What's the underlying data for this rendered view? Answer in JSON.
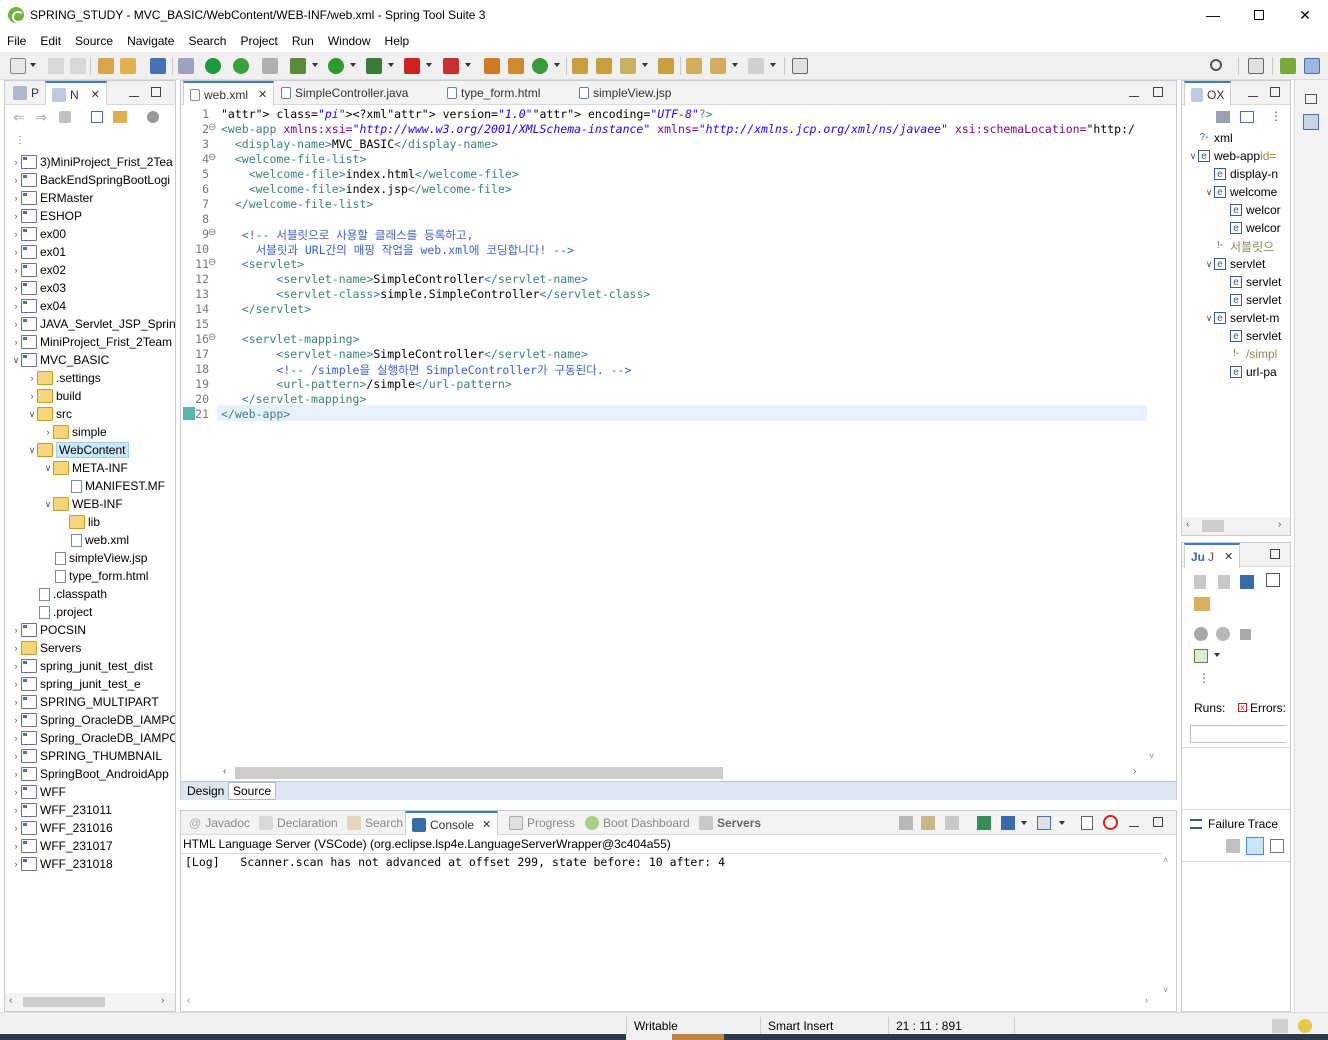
{
  "window": {
    "title": "SPRING_STUDY - MVC_BASIC/WebContent/WEB-INF/web.xml - Spring Tool Suite 3"
  },
  "menu": [
    "File",
    "Edit",
    "Source",
    "Navigate",
    "Search",
    "Project",
    "Run",
    "Window",
    "Help"
  ],
  "explorer": {
    "tabs": [
      "P",
      "N"
    ],
    "items": [
      {
        "label": "3)MiniProject_Frist_2Tea",
        "type": "project",
        "level": 0,
        "open": false
      },
      {
        "label": "BackEndSpringBootLogi",
        "type": "project",
        "level": 0,
        "open": false
      },
      {
        "label": "ERMaster",
        "type": "project",
        "level": 0,
        "open": false
      },
      {
        "label": "ESHOP",
        "type": "project",
        "level": 0,
        "open": false
      },
      {
        "label": "ex00",
        "type": "project",
        "level": 0,
        "open": false
      },
      {
        "label": "ex01",
        "type": "project",
        "level": 0,
        "open": false
      },
      {
        "label": "ex02",
        "type": "project",
        "level": 0,
        "open": false
      },
      {
        "label": "ex03",
        "type": "project",
        "level": 0,
        "open": false
      },
      {
        "label": "ex04",
        "type": "project",
        "level": 0,
        "open": false
      },
      {
        "label": "JAVA_Servlet_JSP_Spring",
        "type": "project",
        "level": 0,
        "open": false
      },
      {
        "label": "MiniProject_Frist_2Team",
        "type": "project",
        "level": 0,
        "open": false
      },
      {
        "label": "MVC_BASIC",
        "type": "project",
        "level": 0,
        "open": true
      },
      {
        "label": ".settings",
        "type": "folder",
        "level": 1,
        "open": false
      },
      {
        "label": "build",
        "type": "folder",
        "level": 1,
        "open": false
      },
      {
        "label": "src",
        "type": "folder",
        "level": 1,
        "open": true
      },
      {
        "label": "simple",
        "type": "folder",
        "level": 2,
        "open": false
      },
      {
        "label": "WebContent",
        "type": "folder",
        "level": 1,
        "open": true,
        "selected": true
      },
      {
        "label": "META-INF",
        "type": "folder",
        "level": 2,
        "open": true
      },
      {
        "label": "MANIFEST.MF",
        "type": "file",
        "level": 3
      },
      {
        "label": "WEB-INF",
        "type": "folder",
        "level": 2,
        "open": true
      },
      {
        "label": "lib",
        "type": "folder",
        "level": 3,
        "leaf": true
      },
      {
        "label": "web.xml",
        "type": "xml",
        "level": 3
      },
      {
        "label": "simpleView.jsp",
        "type": "file",
        "level": 2
      },
      {
        "label": "type_form.html",
        "type": "file",
        "level": 2
      },
      {
        "label": ".classpath",
        "type": "xml",
        "level": 1
      },
      {
        "label": ".project",
        "type": "xml",
        "level": 1
      },
      {
        "label": "POCSIN",
        "type": "project",
        "level": 0,
        "open": false
      },
      {
        "label": "Servers",
        "type": "folder",
        "level": 0,
        "open": false
      },
      {
        "label": "spring_junit_test_dist",
        "type": "project",
        "level": 0,
        "open": false
      },
      {
        "label": "spring_junit_test_e",
        "type": "project",
        "level": 0,
        "open": false
      },
      {
        "label": "SPRING_MULTIPART",
        "type": "project",
        "level": 0,
        "open": false
      },
      {
        "label": "Spring_OracleDB_IAMPO",
        "type": "project",
        "level": 0,
        "open": false
      },
      {
        "label": "Spring_OracleDB_IAMPO",
        "type": "project",
        "level": 0,
        "open": false
      },
      {
        "label": "SPRING_THUMBNAIL",
        "type": "project",
        "level": 0,
        "open": false
      },
      {
        "label": "SpringBoot_AndroidApp",
        "type": "project",
        "level": 0,
        "open": false
      },
      {
        "label": "WFF",
        "type": "project",
        "level": 0,
        "open": false
      },
      {
        "label": "WFF_231011",
        "type": "project",
        "level": 0,
        "open": false
      },
      {
        "label": "WFF_231016",
        "type": "project",
        "level": 0,
        "open": false
      },
      {
        "label": "WFF_231017",
        "type": "project",
        "level": 0,
        "open": false
      },
      {
        "label": "WFF_231018",
        "type": "project",
        "level": 0,
        "open": false
      }
    ]
  },
  "editor": {
    "tabs": [
      {
        "label": "web.xml",
        "active": true
      },
      {
        "label": "SimpleController.java",
        "active": false
      },
      {
        "label": "type_form.html",
        "active": false
      },
      {
        "label": "simpleView.jsp",
        "active": false
      }
    ],
    "lines": [
      "<?xml version=\"1.0\" encoding=\"UTF-8\"?>",
      "<web-app xmlns:xsi=\"http://www.w3.org/2001/XMLSchema-instance\" xmlns=\"http://xmlns.jcp.org/xml/ns/javaee\" xsi:schemaLocation=\"http:/",
      "  <display-name>MVC_BASIC</display-name>",
      "  <welcome-file-list>",
      "    <welcome-file>index.html</welcome-file>",
      "    <welcome-file>index.jsp</welcome-file>",
      "  </welcome-file-list>",
      "",
      "   <!-- 서블릿으로 사용할 클래스를 등록하고,",
      "     서블릿과 URL간의 매핑 작업을 web.xml에 코딩합니다! -->",
      "   <servlet>",
      "        <servlet-name>SimpleController</servlet-name>",
      "        <servlet-class>simple.SimpleController</servlet-class>",
      "   </servlet>",
      "",
      "   <servlet-mapping>",
      "        <servlet-name>SimpleController</servlet-name>",
      "        <!-- /simple을 실행하면 SimpleController가 구동된다. -->",
      "        <url-pattern>/simple</url-pattern>",
      "   </servlet-mapping>",
      "</web-app>"
    ],
    "bottom_tabs": [
      "Design",
      "Source"
    ]
  },
  "outline": {
    "tabs": [
      "O",
      "X"
    ],
    "items": [
      {
        "label": "xml",
        "level": 0,
        "kind": "pi"
      },
      {
        "label": "web-app",
        "suffix": " id=",
        "level": 0,
        "kind": "e",
        "open": true
      },
      {
        "label": "display-n",
        "level": 1,
        "kind": "e"
      },
      {
        "label": "welcome",
        "level": 1,
        "kind": "e",
        "open": true
      },
      {
        "label": "welcor",
        "level": 2,
        "kind": "e"
      },
      {
        "label": "welcor",
        "level": 2,
        "kind": "e"
      },
      {
        "label": "서블릿으",
        "level": 1,
        "kind": "c"
      },
      {
        "label": "servlet",
        "level": 1,
        "kind": "e",
        "open": true
      },
      {
        "label": "servlet",
        "level": 2,
        "kind": "e"
      },
      {
        "label": "servlet",
        "level": 2,
        "kind": "e"
      },
      {
        "label": "servlet-m",
        "level": 1,
        "kind": "e",
        "open": true
      },
      {
        "label": "servlet",
        "level": 2,
        "kind": "e"
      },
      {
        "label": "/simpl",
        "level": 2,
        "kind": "c"
      },
      {
        "label": "url-pa",
        "level": 2,
        "kind": "e"
      }
    ]
  },
  "junit": {
    "tabs": [
      "Ju",
      "J"
    ],
    "runs_label": "Runs:",
    "errors_label": "Errors:",
    "failure_trace_label": "Failure Trace"
  },
  "console": {
    "tabs": [
      "Javadoc",
      "Declaration",
      "Search",
      "Console",
      "Progress",
      "Boot Dashboard",
      "Servers"
    ],
    "active_tab": "Console",
    "header": "HTML Language Server (VSCode) (org.eclipse.lsp4e.LanguageServerWrapper@3c404a55)",
    "log": "[Log]   Scanner.scan has not advanced at offset 299, state before: 10 after: 4"
  },
  "status": {
    "writable": "Writable",
    "insert_mode": "Smart Insert",
    "position": "21 : 11 : 891"
  }
}
